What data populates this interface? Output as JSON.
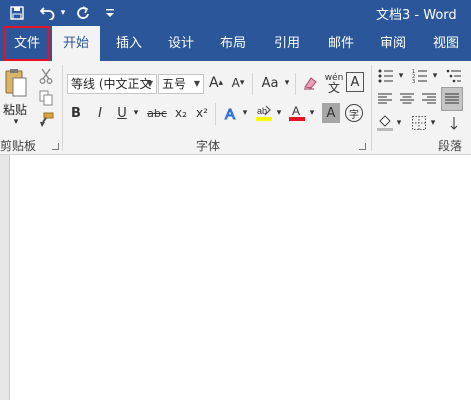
{
  "titlebar": {
    "doc_title": "文档3 - Word",
    "save_icon": "save-icon",
    "undo_icon": "undo-icon",
    "redo_icon": "redo-icon",
    "customize_icon": "customize-qat-icon"
  },
  "tabs": [
    {
      "label": "文件"
    },
    {
      "label": "开始"
    },
    {
      "label": "插入"
    },
    {
      "label": "设计"
    },
    {
      "label": "布局"
    },
    {
      "label": "引用"
    },
    {
      "label": "邮件"
    },
    {
      "label": "审阅"
    },
    {
      "label": "视图"
    }
  ],
  "clipboard": {
    "paste_label": "粘贴",
    "group_label": "剪贴板"
  },
  "font": {
    "font_name": "等线 (中文正文",
    "font_size": "五号",
    "grow": "A",
    "shrink": "A",
    "case": "Aa",
    "bold": "B",
    "italic": "I",
    "underline": "U",
    "strike": "abc",
    "subscript": "x₂",
    "superscript": "x²",
    "phonetic": "wén",
    "border_char": "A",
    "font_color": "A",
    "shading_char": "A",
    "enclose_char": "字",
    "group_label": "字体",
    "highlight_color": "#ffff00",
    "font_color_value": "#e81123"
  },
  "paragraph": {
    "group_label": "段落"
  },
  "colors": {
    "accent": "#2b579a",
    "file_tab_outline": "#e81123"
  }
}
